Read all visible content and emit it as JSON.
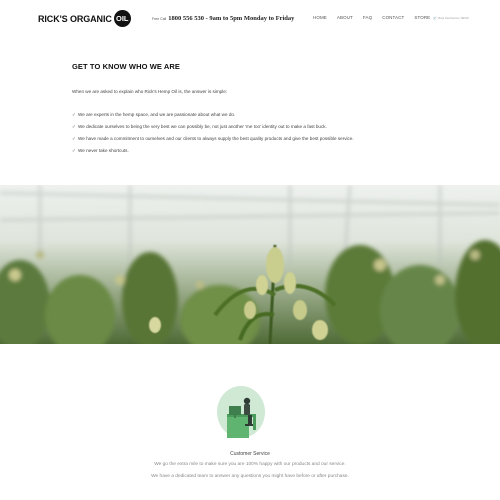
{
  "header": {
    "logo_text": "RICK'S ORGANIC",
    "logo_circle": "OIL",
    "phone_label": "Free Call",
    "phone_text": "1800 556 530 - 9am to 5pm Monday to Friday",
    "nav": [
      "HOME",
      "ABOUT",
      "FAQ",
      "CONTACT",
      "STORE"
    ],
    "cart_text": "View Cart Items / $0.00"
  },
  "about": {
    "title": "GET TO KNOW WHO WE ARE",
    "intro": "When we are asked to explain who Rick's Hemp Oil is, the answer is simple:",
    "check_icon": "✓",
    "bullets": [
      "We are experts in the hemp space, and we are passionate about what we do.",
      "We dedicate ourselves to being the very best we can possibly be, not just another 'me too' identity out to make a fast buck.",
      "We have made a commitment to ourselves and our clients to always supply the best quality products and give the best possible service.",
      "We never take shortcuts."
    ]
  },
  "hero": {
    "image": "hemp-greenhouse-photo"
  },
  "service": {
    "title": "Customer Service",
    "lines": [
      "We go the extra mile to make sure you are 100% happy with our products and our service.",
      "We have a dedicated team to answer any questions you might have before or after purchase."
    ]
  },
  "colors": {
    "accent_green": "#7fc792",
    "text_dark": "#111111"
  }
}
